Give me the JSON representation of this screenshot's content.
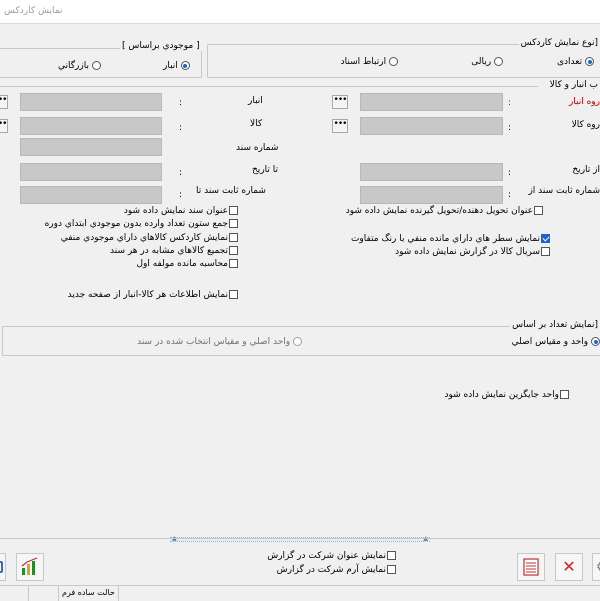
{
  "window": {
    "title": "نمایش کاردکس",
    "title_left_fragment": ""
  },
  "display_type": {
    "legend": "[نوع نمایش کاردکس",
    "options": [
      {
        "label": "تعدادی",
        "selected": true
      },
      {
        "label": "ریالی",
        "selected": false
      },
      {
        "label": "ارتباط اسناد",
        "selected": false
      }
    ]
  },
  "stock_basis": {
    "legend": "[ موجودي براساس ]",
    "options": [
      {
        "label": "انبار",
        "selected": true
      },
      {
        "label": "بازرگاني",
        "selected": false
      }
    ]
  },
  "warehouse_section": {
    "legend": "ب انبار و کالا",
    "warehouse_group_label": "روه انبار",
    "goods_group_label": "روه کالا",
    "warehouse_label": "انبار",
    "goods_label": "کالا",
    "doc_number_label": "شماره سند",
    "from_date_label": "از تاريخ",
    "to_date_label": "تا تاريخ",
    "fixed_doc_from_label": "شماره ثابت سند از",
    "fixed_doc_to_label": "شماره ثابت سند تا",
    "colon": ":",
    "dots": "•••"
  },
  "options_right": [
    {
      "label": "عنوان تحويل دهنده/تحويل گيرنده نمايش داده شود",
      "checked": false
    },
    {
      "label": "نمايش سطر هاي داراي مانده منفي با رنگ متفاوت",
      "checked": true
    },
    {
      "label": "سريال کالا در گزارش نمايش داده شود",
      "checked": false
    }
  ],
  "options_left": [
    {
      "label": "عنوان سند نمايش داده شود",
      "checked": false
    },
    {
      "label": "جمع ستون تعداد وارده بدون موجودي ابتداي دوره",
      "checked": false
    },
    {
      "label": "نمايش کاردکس کالاهاي داراي موجودي منفي",
      "checked": false
    },
    {
      "label": "تجميع کالاهاي مشابه در هر سند",
      "checked": false
    },
    {
      "label": "محاسبه مانده مولفه اول",
      "checked": false
    }
  ],
  "option_per_page": {
    "label": "نمايش اطلاعات هر کالا-انبار از صفحه جديد",
    "checked": false
  },
  "count_basis": {
    "legend": "[نمايش تعداد بر اساس",
    "options": [
      {
        "label": "واحد و مقياس اصلي",
        "selected": true
      },
      {
        "label": "واحد اصلي و مقياس انتخاب شده در سند",
        "selected": false
      }
    ]
  },
  "alt_unit": {
    "label": "واحد جايگزين نمايش داده شود",
    "checked": false
  },
  "footer": {
    "show_company_title": {
      "label": "نمايش عنوان شرکت در گزارش",
      "checked": false
    },
    "show_company_logo": {
      "label": "نمايش آرم شرکت در گزارش",
      "checked": false
    }
  },
  "status": {
    "text": "حالت ساده فرم"
  },
  "colors": {
    "accent": "#1a64d6",
    "required": "#c00000",
    "close_red": "#d42020"
  }
}
